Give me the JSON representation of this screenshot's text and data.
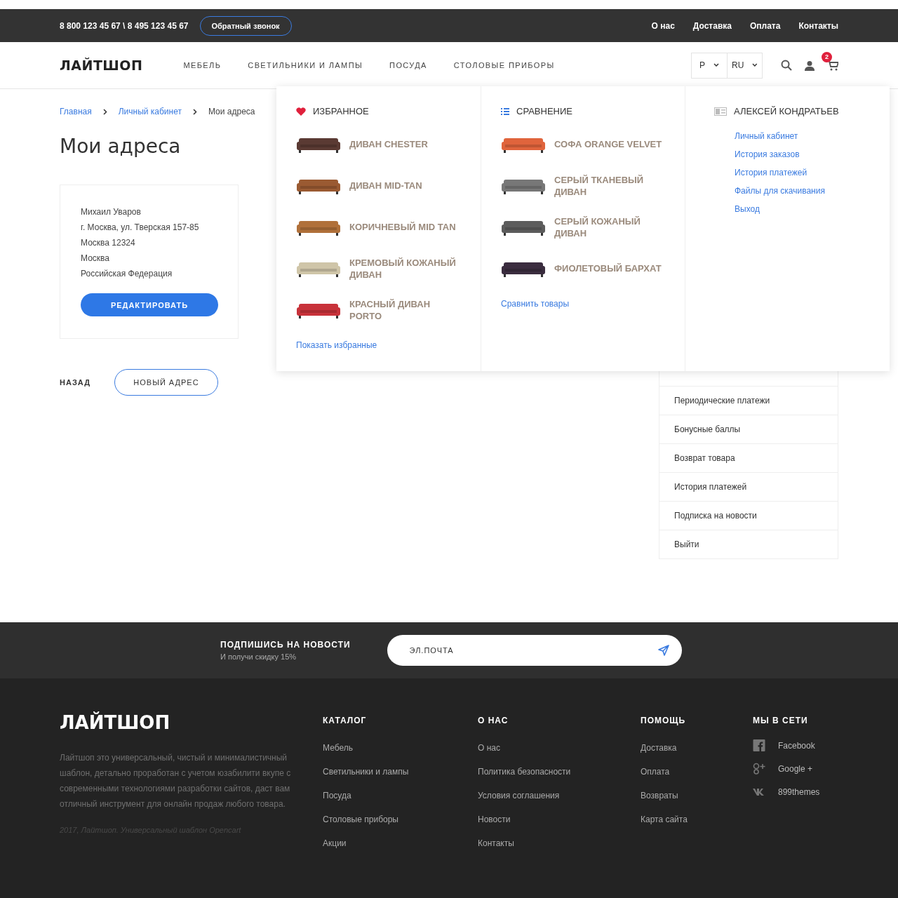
{
  "topbar": {
    "phones": "8 800 123 45 67 \\ 8 495 123 45 67",
    "callback": "Обратный звонок",
    "links": [
      "О нас",
      "Доставка",
      "Оплата",
      "Контакты"
    ]
  },
  "header": {
    "logo": "ЛАЙТШОП",
    "nav": [
      "МЕБЕЛЬ",
      "СВЕТИЛЬНИКИ И ЛАМПЫ",
      "ПОСУДА",
      "СТОЛОВЫЕ ПРИБОРЫ"
    ],
    "currency": "Р",
    "language": "RU",
    "cart_count": "2"
  },
  "breadcrumbs": [
    {
      "label": "Главная",
      "current": false
    },
    {
      "label": "Личный кабинет",
      "current": false
    },
    {
      "label": "Мои адреса",
      "current": true
    }
  ],
  "page_title": "Мои адреса",
  "address": {
    "lines": [
      "Михаил Уваров",
      "г. Москва, ул. Тверская 157-85",
      "Москва 12324",
      "Москва",
      "Российская Федерация"
    ],
    "edit_button": "РЕДАКТИРОВАТЬ"
  },
  "actions": {
    "back": "НАЗАД",
    "new_address": "НОВЫЙ АДРЕС"
  },
  "account_menu": [
    "Периодические платежи",
    "Бонусные баллы",
    "Возврат товара",
    "История платежей",
    "Подписка на новости",
    "Выйти"
  ],
  "dropdown": {
    "favorites": {
      "title": "ИЗБРАННОЕ",
      "items": [
        {
          "name": "ДИВАН CHESTER",
          "color": "#5a3a33"
        },
        {
          "name": "ДИВАН MID-TAN",
          "color": "#9a5a32"
        },
        {
          "name": "КОРИЧНЕВЫЙ MID TAN",
          "color": "#b0703a"
        },
        {
          "name": "КРЕМОВЫЙ КОЖАНЫЙ ДИВАН",
          "color": "#cfc5a8"
        },
        {
          "name": "КРАСНЫЙ ДИВАН PORTO",
          "color": "#c8323a"
        }
      ],
      "link": "Показать избранные"
    },
    "compare": {
      "title": "СРАВНЕНИЕ",
      "items": [
        {
          "name": "СОФА ORANGE VELVET",
          "color": "#e0643c"
        },
        {
          "name": "СЕРЫЙ ТКАНЕВЫЙ ДИВАН",
          "color": "#777777"
        },
        {
          "name": "СЕРЫЙ КОЖАНЫЙ ДИВАН",
          "color": "#5c5c5c"
        },
        {
          "name": "ФИОЛЕТОВЫЙ БАРХАТ",
          "color": "#3a2c3e"
        }
      ],
      "link": "Сравнить товары"
    },
    "account": {
      "title": "АЛЕКСЕЙ КОНДРАТЬЕВ",
      "links": [
        "Личный кабинет",
        "История заказов",
        "История платежей",
        "Файлы для скачивания",
        "Выход"
      ]
    }
  },
  "newsletter": {
    "title": "ПОДПИШИСЬ НА НОВОСТИ",
    "subtitle": "И получи скидку 15%",
    "placeholder": "ЭЛ.ПОЧТА"
  },
  "footer": {
    "logo": "ЛАЙТШОП",
    "description": "Лайтшоп это универсальный, чистый и минималистичный шаблон, детально проработан с учетом юзабилити вкупе с современными технологиями разработки сайтов, даст вам отличный инструмент для онлайн продаж любого товара.",
    "copyright": "2017, Лайтшоп. Универсальный шаблон Opencart",
    "columns": [
      {
        "title": "КАТАЛОГ",
        "links": [
          "Мебель",
          "Светильники и лампы",
          "Посуда",
          "Столовые приборы",
          "Акции"
        ]
      },
      {
        "title": "О НАС",
        "links": [
          "О нас",
          "Политика безопасности",
          "Условия соглашения",
          "Новости",
          "Контакты"
        ]
      },
      {
        "title": "ПОМОЩЬ",
        "links": [
          "Доставка",
          "Оплата",
          "Возвраты",
          "Карта сайта"
        ]
      }
    ],
    "social": {
      "title": "МЫ В СЕТИ",
      "links": [
        {
          "kind": "facebook",
          "label": "Facebook"
        },
        {
          "kind": "googleplus",
          "label": "Google +"
        },
        {
          "kind": "vk",
          "label": "899themes"
        }
      ]
    }
  }
}
